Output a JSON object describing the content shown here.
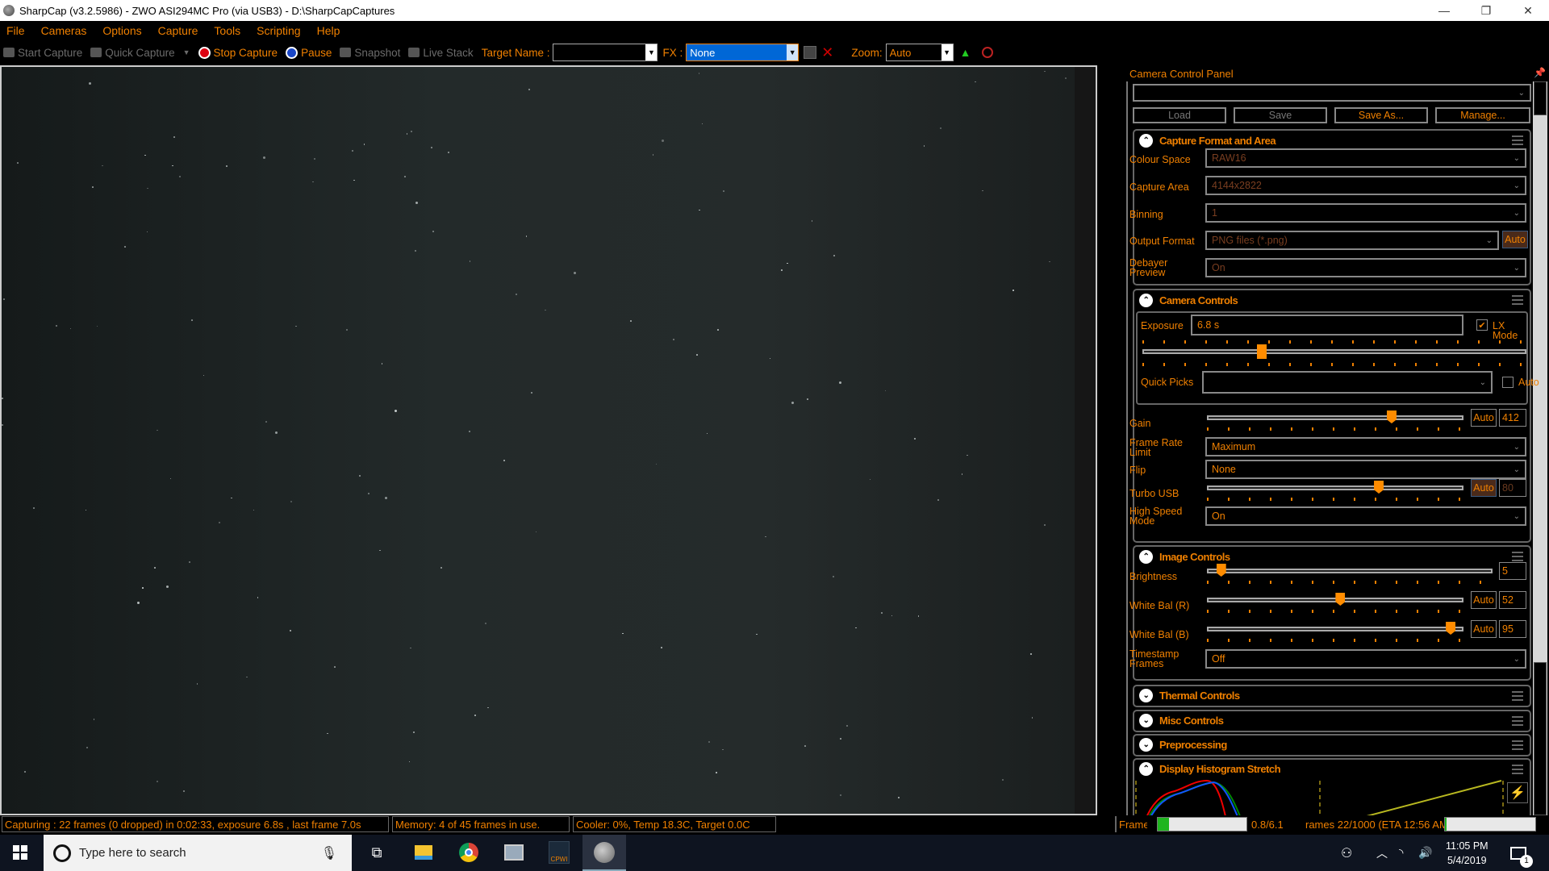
{
  "window": {
    "title": "SharpCap (v3.2.5986) - ZWO ASI294MC Pro (via USB3) - D:\\SharpCapCaptures",
    "minimize": "—",
    "restore": "❐",
    "close": "✕"
  },
  "menu": [
    "File",
    "Cameras",
    "Options",
    "Capture",
    "Tools",
    "Scripting",
    "Help"
  ],
  "toolbar": {
    "start_capture": "Start Capture",
    "quick_capture": "Quick Capture",
    "stop_capture": "Stop Capture",
    "pause": "Pause",
    "snapshot": "Snapshot",
    "live_stack": "Live Stack",
    "target_name_label": "Target Name :",
    "target_name_value": "",
    "fx_label": "FX :",
    "fx_value": "None",
    "zoom_label": "Zoom:",
    "zoom_value": "Auto"
  },
  "panel": {
    "title": "Camera Control Panel",
    "profile_value": "",
    "buttons": {
      "load": "Load",
      "save": "Save",
      "save_as": "Save As...",
      "manage": "Manage..."
    },
    "capture_format": {
      "title": "Capture Format and Area",
      "colour_space_label": "Colour Space",
      "colour_space": "RAW16",
      "capture_area_label": "Capture Area",
      "capture_area": "4144x2822",
      "binning_label": "Binning",
      "binning": "1",
      "output_format_label": "Output Format",
      "output_format": "PNG files (*.png)",
      "output_auto": "Auto",
      "debayer_label_1": "Debayer",
      "debayer_label_2": "Preview",
      "debayer": "On"
    },
    "camera_controls": {
      "title": "Camera Controls",
      "exposure_label": "Exposure",
      "exposure": "6.8 s",
      "lx_mode_label": "LX Mode",
      "lx_mode_checked": true,
      "exposure_slider_fraction": 0.31,
      "quick_picks_label": "Quick Picks",
      "quick_picks": "",
      "quick_auto_label": "Auto",
      "gain_label": "Gain",
      "gain_auto": "Auto",
      "gain": "412",
      "gain_fraction": 0.72,
      "frame_rate_label_1": "Frame Rate",
      "frame_rate_label_2": "Limit",
      "frame_rate": "Maximum",
      "flip_label": "Flip",
      "flip": "None",
      "turbo_label": "Turbo USB",
      "turbo_auto": "Auto",
      "turbo": "80",
      "turbo_fraction": 0.67,
      "high_speed_label_1": "High Speed",
      "high_speed_label_2": "Mode",
      "high_speed": "On"
    },
    "image_controls": {
      "title": "Image Controls",
      "brightness_label": "Brightness",
      "brightness": "5",
      "brightness_fraction": 0.05,
      "wb_r_label": "White Bal (R)",
      "wb_r_auto": "Auto",
      "wb_r": "52",
      "wb_r_fraction": 0.52,
      "wb_b_label": "White Bal (B)",
      "wb_b_auto": "Auto",
      "wb_b": "95",
      "wb_b_fraction": 0.95,
      "timestamp_label_1": "Timestamp",
      "timestamp_label_2": "Frames",
      "timestamp": "Off"
    },
    "collapsed_sections": [
      "Thermal Controls",
      "Misc Controls",
      "Preprocessing"
    ],
    "histogram": {
      "title": "Display Histogram Stretch"
    }
  },
  "status": {
    "capturing": "Capturing : 22 frames (0 dropped) in 0:02:33, exposure 6.8s , last frame 7.0s",
    "memory": "Memory: 4 of 45 frames in use.",
    "cooler": "Cooler: 0%, Temp 18.3C, Target 0.0C",
    "frame_label": "Frame:",
    "frame_progress": "0.8/6.1",
    "frame_fraction": 0.13,
    "frames_eta": "rames 22/1000 (ETA 12:56 AM",
    "frames_fraction": 0.02
  },
  "taskbar": {
    "search_placeholder": "Type here to search",
    "time": "11:05 PM",
    "date": "5/4/2019",
    "notification_count": "1"
  }
}
